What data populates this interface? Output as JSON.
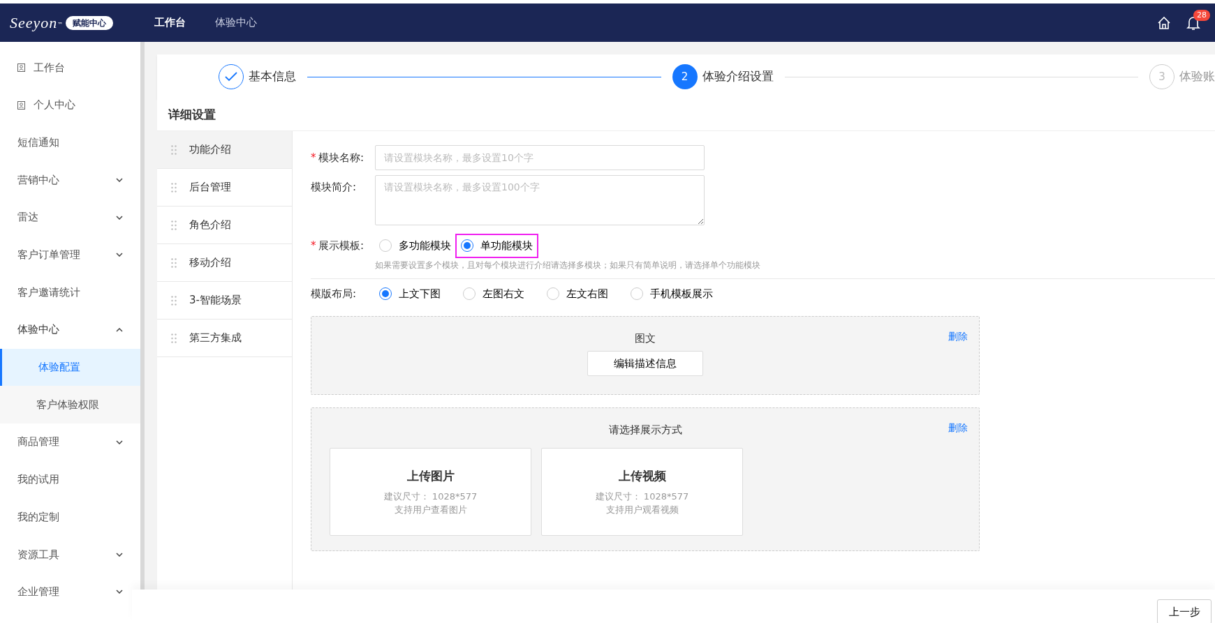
{
  "header": {
    "logo": "Seeyon",
    "logo_mark": "™",
    "logo_badge": "赋能中心",
    "nav": [
      {
        "label": "工作台",
        "selected": true
      },
      {
        "label": "体验中心",
        "selected": false
      }
    ],
    "notifications": "28"
  },
  "sidebar": {
    "items": [
      {
        "label": "工作台",
        "kind": "icon",
        "selected": false
      },
      {
        "label": "个人中心",
        "kind": "icon",
        "selected": false
      },
      {
        "label": "短信通知",
        "kind": "plain",
        "selected": false
      },
      {
        "label": "营销中心",
        "kind": "group",
        "expanded": false,
        "selected": false
      },
      {
        "label": "雷达",
        "kind": "group",
        "expanded": false,
        "selected": false
      },
      {
        "label": "客户订单管理",
        "kind": "group",
        "expanded": false,
        "selected": false
      },
      {
        "label": "客户邀请统计",
        "kind": "plain",
        "selected": false
      },
      {
        "label": "体验中心",
        "kind": "group",
        "expanded": true,
        "selected": false,
        "children": [
          {
            "label": "体验配置",
            "selected": true
          },
          {
            "label": "客户体验权限",
            "selected": false
          }
        ]
      },
      {
        "label": "商品管理",
        "kind": "group",
        "expanded": false,
        "selected": false
      },
      {
        "label": "我的试用",
        "kind": "plain",
        "selected": false
      },
      {
        "label": "我的定制",
        "kind": "plain",
        "selected": false
      },
      {
        "label": "资源工具",
        "kind": "group",
        "expanded": false,
        "selected": false
      },
      {
        "label": "企业管理",
        "kind": "group",
        "expanded": false,
        "selected": false
      }
    ]
  },
  "steps": [
    {
      "title": "基本信息",
      "done": true,
      "selected": false
    },
    {
      "marker": "2",
      "title": "体验介绍设置",
      "done": false,
      "selected": true
    },
    {
      "marker": "3",
      "title": "体验账",
      "done": false,
      "selected": false
    }
  ],
  "section_title": "详细设置",
  "module_list": [
    {
      "label": "功能介绍",
      "selected": true
    },
    {
      "label": "后台管理",
      "selected": false
    },
    {
      "label": "角色介绍",
      "selected": false
    },
    {
      "label": "移动介绍",
      "selected": false
    },
    {
      "label": "3-智能场景",
      "selected": false
    },
    {
      "label": "第三方集成",
      "selected": false
    }
  ],
  "form": {
    "name": {
      "required_mark": "*",
      "label": "模块名称:",
      "placeholder": "请设置模块名称，最多设置10个字"
    },
    "intro": {
      "label": "模块简介:",
      "placeholder": "请设置模块名称，最多设置100个字"
    },
    "template": {
      "required_mark": "*",
      "label": "展示模板:",
      "options": [
        {
          "label": "多功能模块",
          "selected": false,
          "highlighted": false
        },
        {
          "label": "单功能模块",
          "selected": true,
          "highlighted": true
        }
      ],
      "hint": "如果需要设置多个模块，且对每个模块进行介绍请选择多模块；如果只有简单说明，请选择单个功能模块"
    },
    "layout": {
      "label": "模版布局:",
      "options": [
        {
          "label": "上文下图",
          "selected": true
        },
        {
          "label": "左图右文",
          "selected": false
        },
        {
          "label": "左文右图",
          "selected": false
        },
        {
          "label": "手机模板展示",
          "selected": false
        }
      ]
    }
  },
  "blocks": [
    {
      "kind": "text",
      "title": "图文",
      "delete": "删除",
      "button": "编辑描述信息"
    },
    {
      "kind": "media",
      "title": "请选择展示方式",
      "delete": "删除",
      "options": [
        {
          "title": "上传图片",
          "size": "建议尺寸： 1028*577",
          "desc": "支持用户查看图片"
        },
        {
          "title": "上传视频",
          "size": "建议尺寸： 1028*577",
          "desc": "支持用户观看视频"
        }
      ]
    }
  ],
  "footer": {
    "prev_button": "上一步"
  }
}
